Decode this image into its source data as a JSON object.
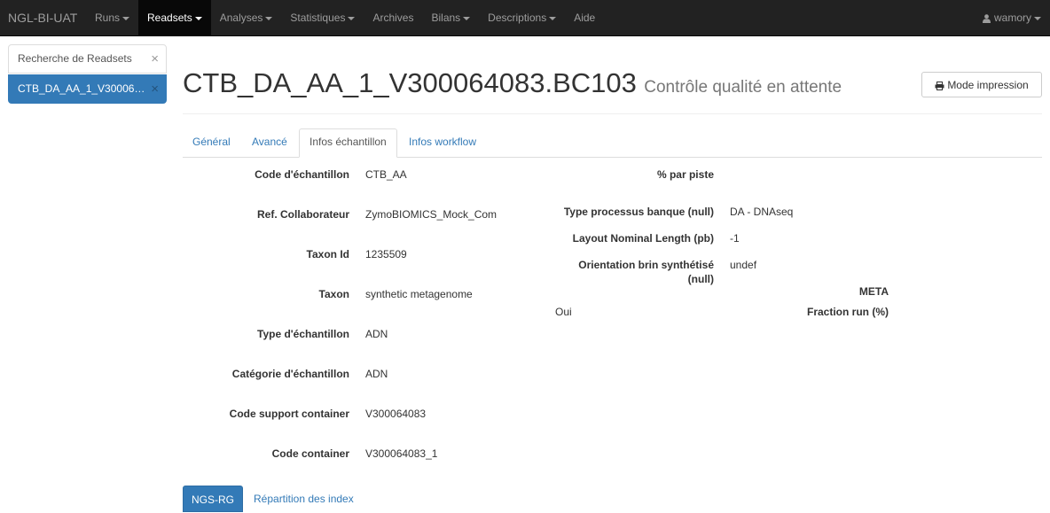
{
  "navbar": {
    "brand": "NGL-BI-UAT",
    "items": [
      {
        "label": "Runs",
        "dropdown": true,
        "active": false
      },
      {
        "label": "Readsets",
        "dropdown": true,
        "active": true
      },
      {
        "label": "Analyses",
        "dropdown": true,
        "active": false
      },
      {
        "label": "Statistiques",
        "dropdown": true,
        "active": false
      },
      {
        "label": "Archives",
        "dropdown": false,
        "active": false
      },
      {
        "label": "Bilans",
        "dropdown": true,
        "active": false
      },
      {
        "label": "Descriptions",
        "dropdown": true,
        "active": false
      },
      {
        "label": "Aide",
        "dropdown": false,
        "active": false
      }
    ],
    "user": "wamory"
  },
  "sidebar": {
    "items": [
      {
        "label": "Recherche de Readsets",
        "active": false
      },
      {
        "label": "CTB_DA_AA_1_V300064083.BC103",
        "active": true
      }
    ],
    "close_glyph": "×"
  },
  "header": {
    "title": "CTB_DA_AA_1_V300064083.BC103",
    "subtitle": "Contrôle qualité en attente",
    "print_button": "Mode impression"
  },
  "tabs": [
    {
      "label": "Général",
      "active": false
    },
    {
      "label": "Avancé",
      "active": false
    },
    {
      "label": "Infos échantillon",
      "active": true
    },
    {
      "label": "Infos workflow",
      "active": false
    }
  ],
  "left_fields": [
    {
      "label": "Code d'échantillon",
      "value": "CTB_AA"
    },
    {
      "label": "Ref. Collaborateur",
      "value": "ZymoBIOMICS_Mock_Com"
    },
    {
      "label": "Taxon Id",
      "value": "1235509"
    },
    {
      "label": "Taxon",
      "value": "synthetic metagenome"
    },
    {
      "label": "Type d'échantillon",
      "value": "ADN"
    },
    {
      "label": "Catégorie d'échantillon",
      "value": "ADN"
    },
    {
      "label": "Code support container",
      "value": "V300064083"
    },
    {
      "label": "Code container",
      "value": "V300064083_1"
    }
  ],
  "right_fields": {
    "percent_lane_label": "% par piste",
    "process_type_label": "Type processus banque (null)",
    "process_type_value": "DA - DNAseq",
    "layout_label": "Layout Nominal Length (pb)",
    "layout_value": "-1",
    "orientation_label_line1": "Orientation brin synthétisé",
    "orientation_label_line2": "(null)",
    "orientation_value": "undef",
    "meta_label": "META",
    "meta_value": "Oui",
    "fraction_label": "Fraction run (%)"
  },
  "bottom": {
    "primary_button": "NGS-RG",
    "link": "Répartition des index"
  },
  "colors": {
    "navbar_bg": "#222222",
    "accent": "#337ab7"
  }
}
